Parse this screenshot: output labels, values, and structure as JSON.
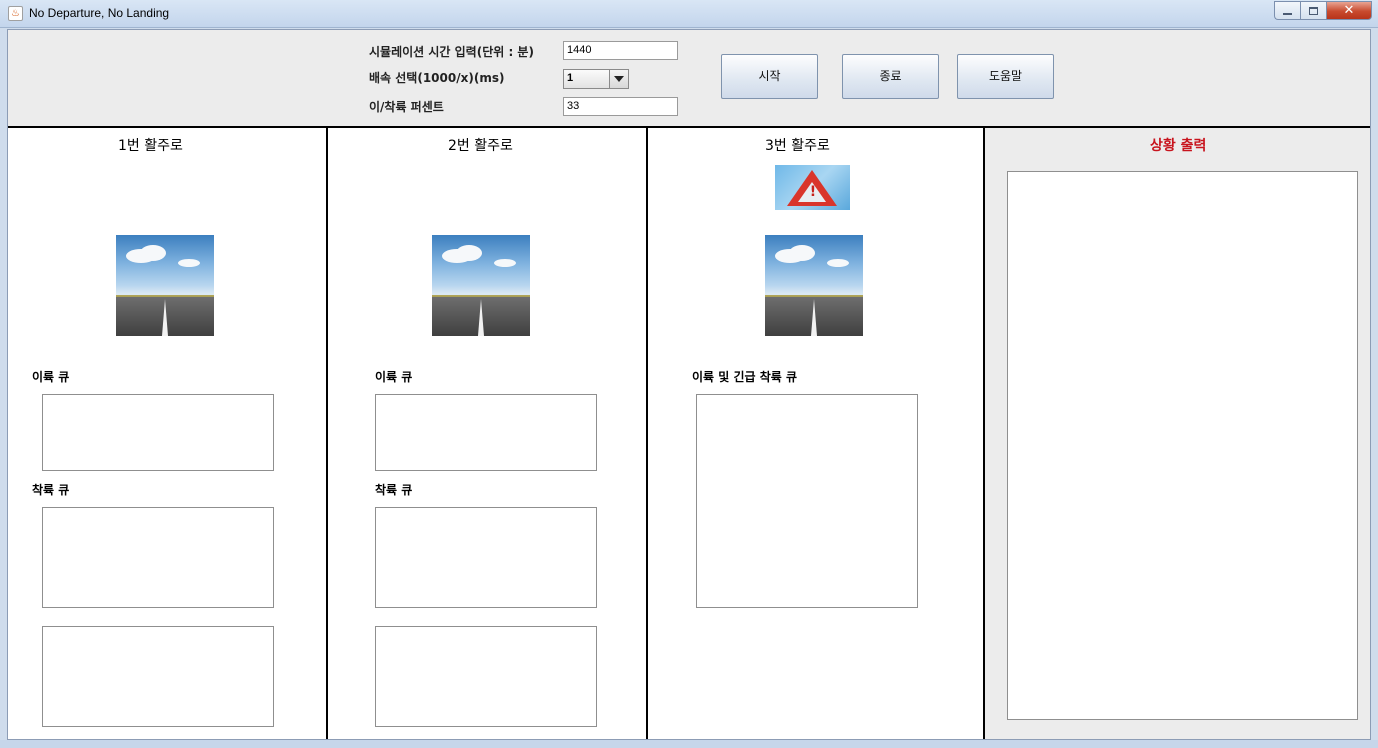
{
  "window": {
    "title": "No Departure, No Landing",
    "app_icon": "java-icon",
    "close_glyph": "✕"
  },
  "controls": {
    "sim_time_label": "시뮬레이션 시간 입력(단위 : 분)",
    "sim_time_value": "1440",
    "speed_label": "배속 선택(1000/x)(ms)",
    "speed_selected": "1",
    "percent_label": "이/착륙 퍼센트",
    "percent_value": "33",
    "start_button": "시작",
    "stop_button": "종료",
    "help_button": "도움말"
  },
  "runways": [
    {
      "title": "1번 활주로",
      "takeoff_queue_label": "이륙 큐",
      "landing_queue_label": "착륙 큐"
    },
    {
      "title": "2번 활주로",
      "takeoff_queue_label": "이륙 큐",
      "landing_queue_label": "착륙 큐"
    },
    {
      "title": "3번 활주로",
      "queue_label": "이륙 및 긴급 착륙 큐",
      "warning_icon": "warning-triangle-icon"
    }
  ],
  "status": {
    "title": "상황 출력",
    "title_color": "#c8141e"
  }
}
